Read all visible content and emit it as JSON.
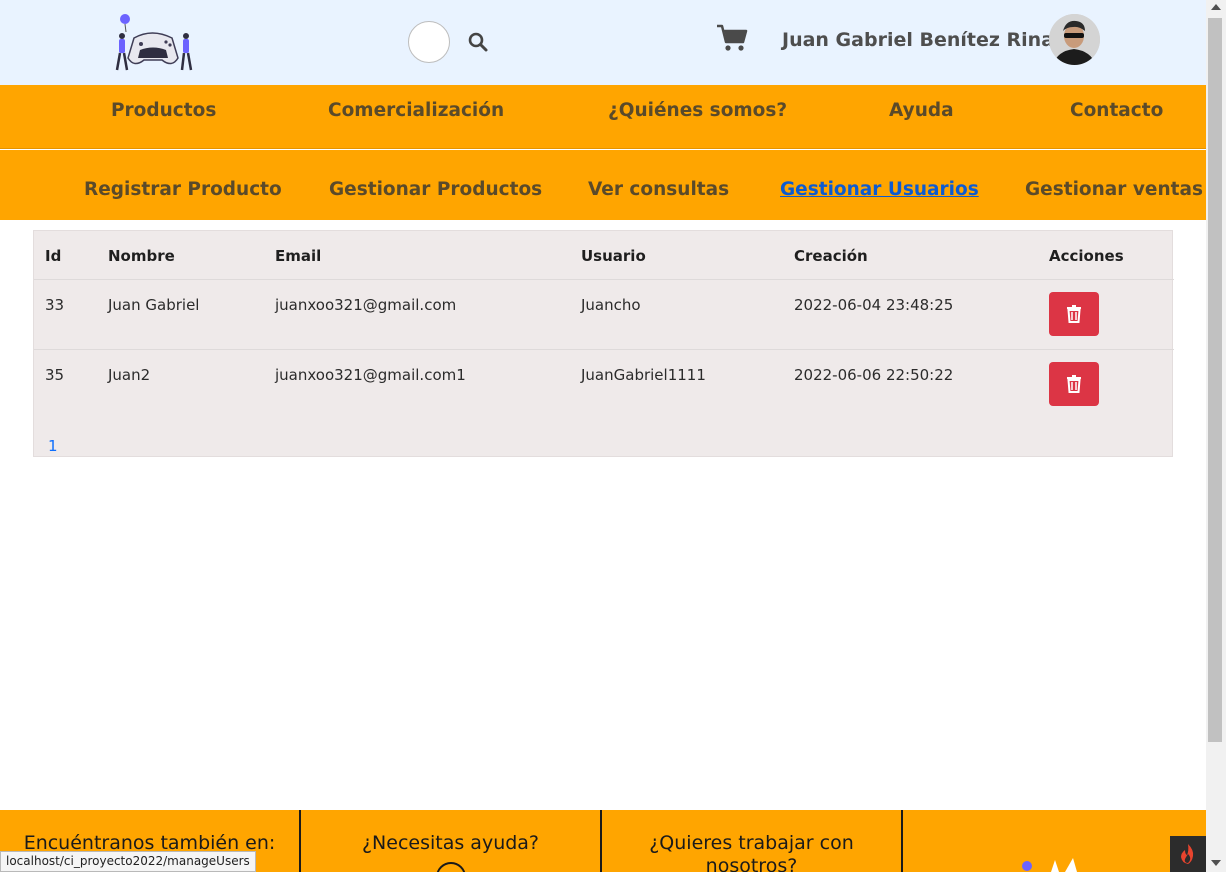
{
  "header": {
    "user_name": "Juan Gabriel Benítez Rinas",
    "icons": {
      "search": "search-icon",
      "cart": "cart-icon",
      "logo": "gamepad-logo",
      "avatar": "user-avatar"
    }
  },
  "nav_main": [
    {
      "label": "Productos"
    },
    {
      "label": "Comercialización"
    },
    {
      "label": "¿Quiénes somos?"
    },
    {
      "label": "Ayuda"
    },
    {
      "label": "Contacto"
    }
  ],
  "nav_admin": [
    {
      "label": "Registrar Producto"
    },
    {
      "label": "Gestionar Productos"
    },
    {
      "label": "Ver consultas"
    },
    {
      "label": "Gestionar Usuarios",
      "active": true
    },
    {
      "label": "Gestionar ventas"
    }
  ],
  "users_table": {
    "headers": [
      "Id",
      "Nombre",
      "Email",
      "Usuario",
      "Creación",
      "Acciones"
    ],
    "rows": [
      {
        "id": "33",
        "nombre": "Juan Gabriel",
        "email": "juanxoo321@gmail.com",
        "usuario": "Juancho",
        "creacion": "2022-06-04 23:48:25"
      },
      {
        "id": "35",
        "nombre": "Juan2",
        "email": "juanxoo321@gmail.com1",
        "usuario": "JuanGabriel1111",
        "creacion": "2022-06-06 22:50:22"
      }
    ],
    "delete_icon": "trash-icon",
    "pagination": {
      "current_page": "1"
    }
  },
  "footer": {
    "columns": [
      {
        "title": "Encuéntranos también en:"
      },
      {
        "title": "¿Necesitas ayuda?"
      },
      {
        "title": "¿Quieres trabajar con nosotros?"
      }
    ]
  },
  "status_bar": {
    "url": "localhost/ci_proyecto2022/manageUsers"
  },
  "colors": {
    "header_bg": "#e9f3ff",
    "nav_bg": "#ffa500",
    "nav_text": "#5a4a2a",
    "active_link": "#0d5bd1",
    "danger": "#dc3545",
    "table_bg": "#efeaea"
  }
}
